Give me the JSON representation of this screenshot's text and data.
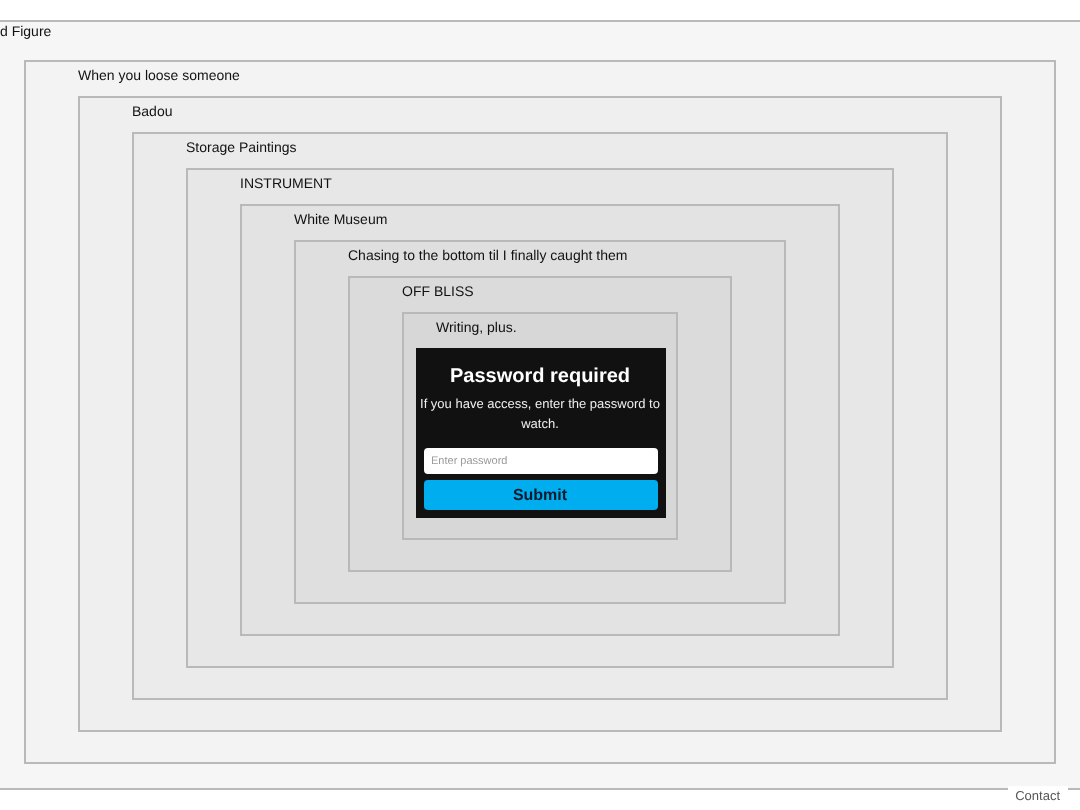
{
  "frame": {
    "title": "d Figure",
    "children": [
      {
        "title": "When you loose someone",
        "children": [
          {
            "title": "Badou",
            "children": [
              {
                "title": "Storage Paintings",
                "children": [
                  {
                    "title": "INSTRUMENT",
                    "children": [
                      {
                        "title": "White Museum",
                        "children": [
                          {
                            "title": "Chasing to the bottom til I finally caught them",
                            "children": [
                              {
                                "title": "OFF BLISS",
                                "children": [
                                  {
                                    "title": "Writing, plus.",
                                    "dialog": {
                                      "title": "Password required",
                                      "message": "If you have access, enter the password to watch.",
                                      "placeholder": "Enter password",
                                      "button": "Submit"
                                    }
                                  }
                                ]
                              }
                            ]
                          }
                        ]
                      }
                    ]
                  }
                ]
              }
            ]
          }
        ]
      }
    ]
  },
  "footer_link": "Contact"
}
